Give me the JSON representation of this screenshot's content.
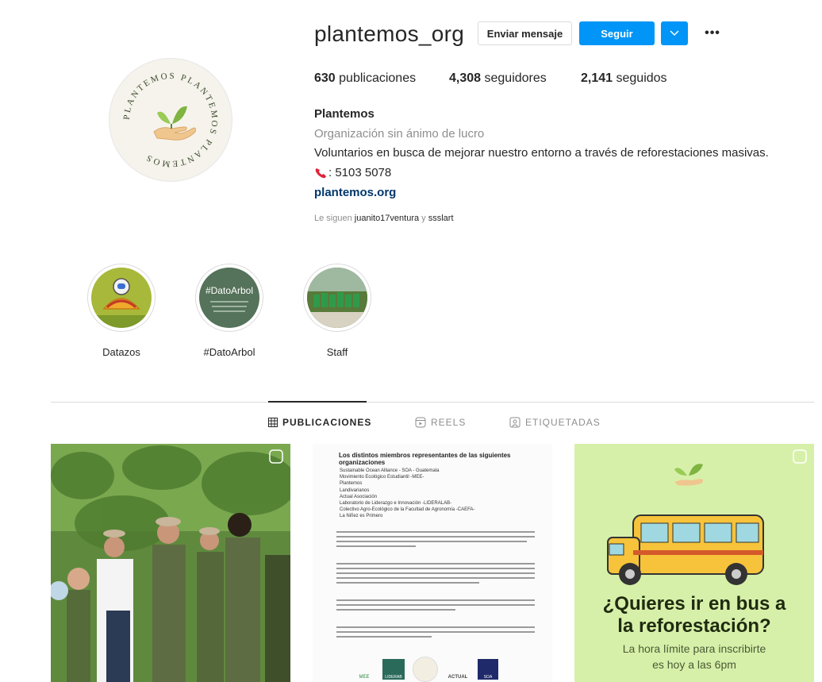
{
  "profile": {
    "username": "plantemos_org",
    "message_button": "Enviar mensaje",
    "follow_button": "Seguir",
    "more_glyph": "•••",
    "dropdown_glyph": "⌵",
    "stats": {
      "posts_count": "630",
      "posts_label": " publicaciones",
      "followers_count": "4,308",
      "followers_label": " seguidores",
      "following_count": "2,141",
      "following_label": " seguidos"
    },
    "full_name": "Plantemos",
    "category": "Organización sin ánimo de lucro",
    "bio": "Voluntarios en busca de mejorar nuestro entorno a través de reforestaciones masivas.",
    "phone": ": 5103 5078",
    "website": "plantemos.org",
    "followed_by_prefix": "Le siguen ",
    "followed_by_user1": "juanito17ventura",
    "followed_by_joiner": " y ",
    "followed_by_user2": "ssslart",
    "logo_text": "PLANTEMOS PLANTEMOS PLANTEMOS"
  },
  "highlights": [
    {
      "label": "Datazos"
    },
    {
      "label": "#DatoArbol",
      "cover_text": "#DatoArbol"
    },
    {
      "label": "Staff"
    }
  ],
  "tabs": [
    {
      "label": "PUBLICACIONES",
      "icon": "grid-icon",
      "active": true
    },
    {
      "label": "REELS",
      "icon": "reels-icon",
      "active": false
    },
    {
      "label": "ETIQUETADAS",
      "icon": "tagged-icon",
      "active": false
    }
  ],
  "posts": {
    "post2": {
      "title": "Los distintos miembros representantes de las siguientes organizaciones",
      "orgs": [
        "Sustainable Ocean Alliance - SOA - Guatemala",
        "Movimiento Ecológico Estudiantil -MEE-",
        "Plantemos",
        "Landivarianos",
        "Actual Asociación",
        "Laboratorio de Liderazgo e Innovación -LIDERALAB-",
        "Colectivo Agro-Ecológico de la Facultad de Agronomía -CAEFA-",
        "La Niñez es Primero"
      ],
      "logos": [
        "MEE",
        "LIDERAB",
        "ACTUAL",
        "SOA"
      ]
    },
    "post3": {
      "headline1": "¿Quieres ir en bus a",
      "headline2": "la reforestación?",
      "sub1": "La hora límite para inscribirte",
      "sub2": "es hoy a las 6pm"
    }
  },
  "colors": {
    "accent": "#0095f6",
    "link": "#00376b",
    "muted": "#8e8e8e",
    "post3_bg": "#d7f0a9",
    "bus_yellow": "#f6c33a"
  }
}
